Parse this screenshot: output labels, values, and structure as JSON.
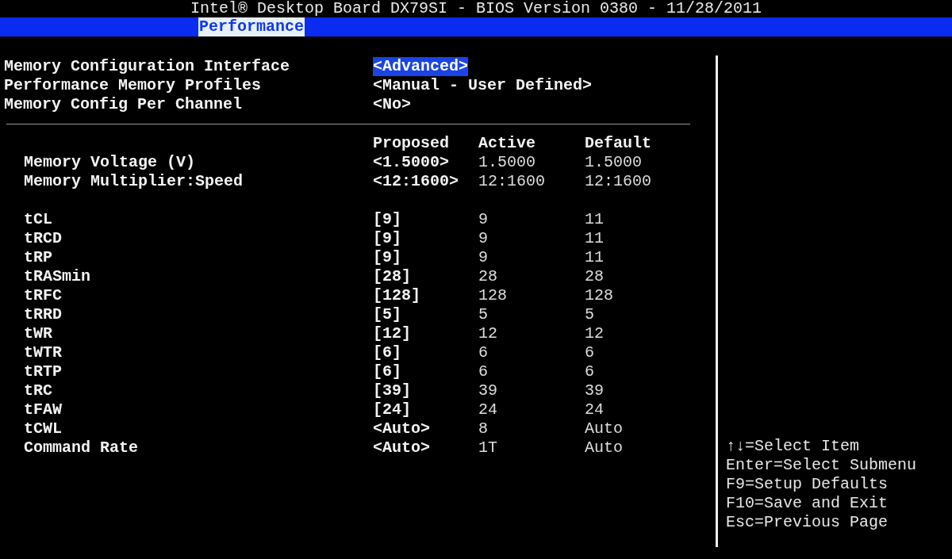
{
  "window": {
    "title": "Intel® Desktop Board DX79SI - BIOS Version 0380 - 11/28/2011"
  },
  "tabs": [
    {
      "label": "Performance",
      "selected": true
    }
  ],
  "settings": [
    {
      "label": "Memory Configuration Interface",
      "value": "<Advanced>",
      "selected": true
    },
    {
      "label": "Performance Memory Profiles",
      "value": "<Manual - User Defined>",
      "selected": false
    },
    {
      "label": "Memory Config Per Channel",
      "value": "<No>",
      "selected": false
    }
  ],
  "table": {
    "columns": [
      "Proposed",
      "Active",
      "Default"
    ],
    "groups": [
      [
        {
          "label": "Memory Voltage (V)",
          "proposed": "<1.5000>",
          "active": "1.5000",
          "default": "1.5000"
        },
        {
          "label": "Memory Multiplier:Speed",
          "proposed": "<12:1600>",
          "active": "12:1600",
          "default": "12:1600"
        }
      ],
      [
        {
          "label": "tCL",
          "proposed": "[9]",
          "active": "9",
          "default": "11"
        },
        {
          "label": "tRCD",
          "proposed": "[9]",
          "active": "9",
          "default": "11"
        },
        {
          "label": "tRP",
          "proposed": "[9]",
          "active": "9",
          "default": "11"
        },
        {
          "label": "tRASmin",
          "proposed": "[28]",
          "active": "28",
          "default": "28"
        },
        {
          "label": "tRFC",
          "proposed": "[128]",
          "active": "128",
          "default": "128"
        },
        {
          "label": "tRRD",
          "proposed": "[5]",
          "active": "5",
          "default": "5"
        },
        {
          "label": "tWR",
          "proposed": "[12]",
          "active": "12",
          "default": "12"
        },
        {
          "label": "tWTR",
          "proposed": "[6]",
          "active": "6",
          "default": "6"
        },
        {
          "label": "tRTP",
          "proposed": "[6]",
          "active": "6",
          "default": "6"
        },
        {
          "label": "tRC",
          "proposed": "[39]",
          "active": "39",
          "default": "39"
        },
        {
          "label": "tFAW",
          "proposed": "[24]",
          "active": "24",
          "default": "24"
        },
        {
          "label": "tCWL",
          "proposed": "<Auto>",
          "active": "8",
          "default": "Auto"
        },
        {
          "label": "Command Rate",
          "proposed": "<Auto>",
          "active": "1T",
          "default": "Auto"
        }
      ]
    ]
  },
  "help": [
    "↑↓=Select Item",
    "Enter=Select Submenu",
    "F9=Setup Defaults",
    "F10=Save and Exit",
    "Esc=Previous Page"
  ]
}
